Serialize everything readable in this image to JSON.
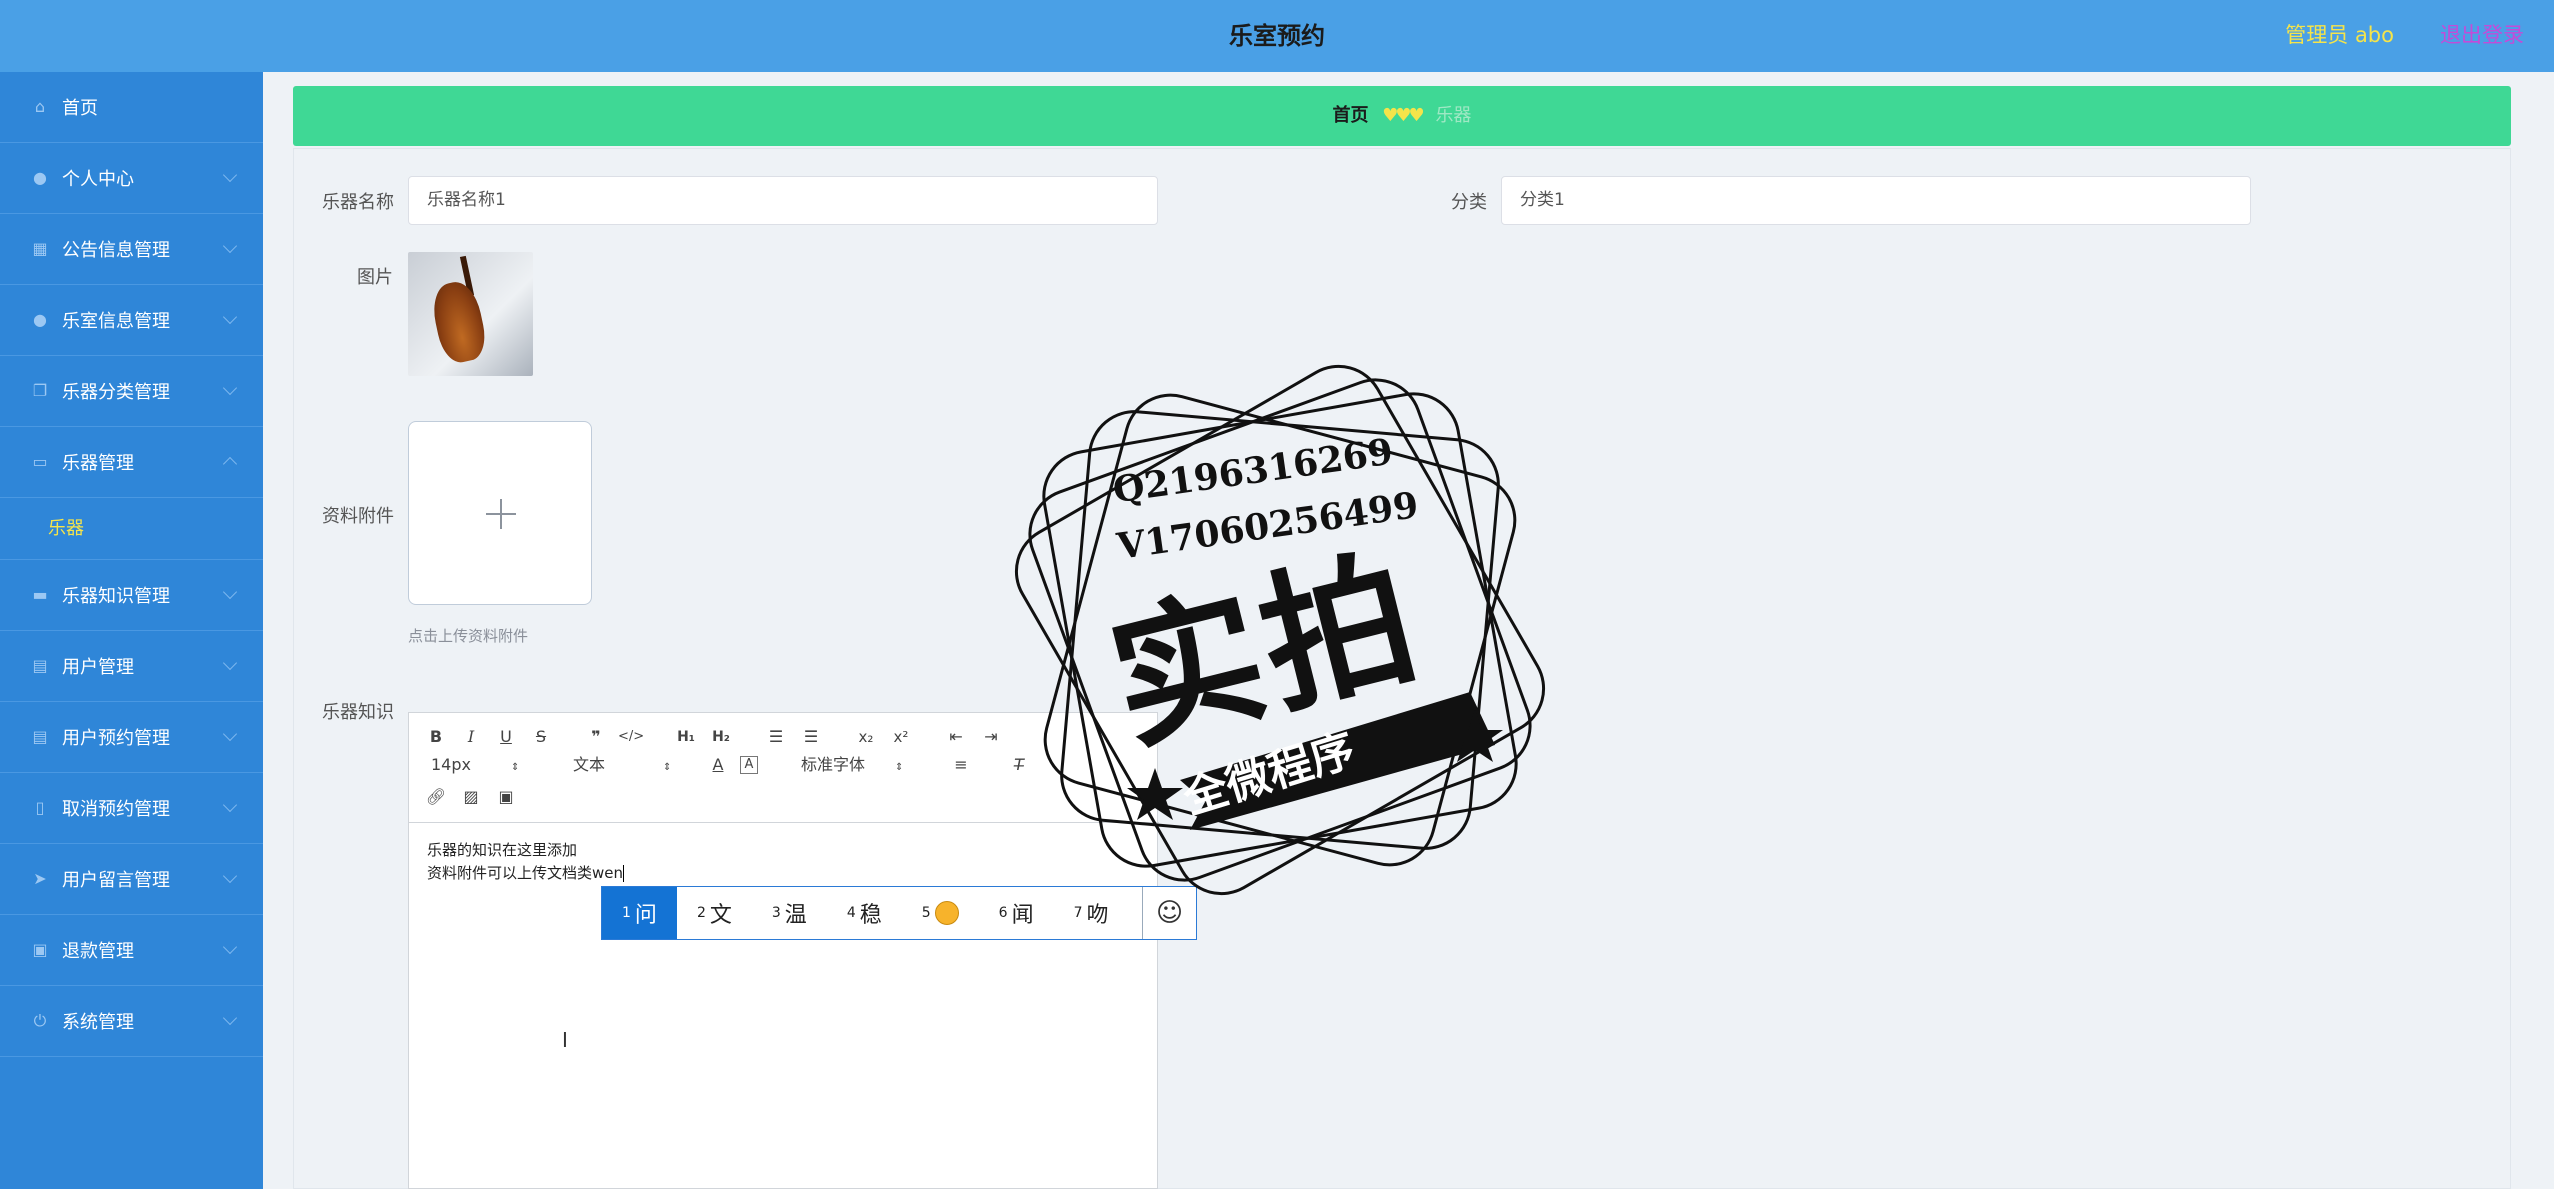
{
  "header": {
    "title": "乐室预约",
    "admin": "管理员 abo",
    "logout": "退出登录"
  },
  "sidebar": {
    "items": [
      {
        "label": "首页",
        "icon": "home-icon"
      },
      {
        "label": "个人中心",
        "icon": "user-icon"
      },
      {
        "label": "公告信息管理",
        "icon": "grid-icon"
      },
      {
        "label": "乐室信息管理",
        "icon": "user-icon"
      },
      {
        "label": "乐器分类管理",
        "icon": "copy-icon"
      },
      {
        "label": "乐器管理",
        "icon": "message-icon"
      },
      {
        "label": "乐器知识管理",
        "icon": "briefcase-icon"
      },
      {
        "label": "用户管理",
        "icon": "clipboard-icon"
      },
      {
        "label": "用户预约管理",
        "icon": "clipboard-icon"
      },
      {
        "label": "取消预约管理",
        "icon": "phone-icon"
      },
      {
        "label": "用户留言管理",
        "icon": "send-icon"
      },
      {
        "label": "退款管理",
        "icon": "image-icon"
      },
      {
        "label": "系统管理",
        "icon": "power-icon"
      }
    ],
    "submenu": {
      "label": "乐器"
    }
  },
  "breadcrumb": {
    "home": "首页",
    "sep": "♥♥♥",
    "current": "乐器"
  },
  "form": {
    "name_label": "乐器名称",
    "name_value": "乐器名称1",
    "category_label": "分类",
    "category_value": "分类1",
    "image_label": "图片",
    "attachment_label": "资料附件",
    "attachment_hint": "点击上传资料附件",
    "knowledge_label": "乐器知识"
  },
  "editor": {
    "font_size": "14px",
    "text_style": "文本",
    "font_family": "标准字体",
    "line1": "乐器的知识在这里添加",
    "line2": "资料附件可以上传文档类wen"
  },
  "ime": {
    "candidates": [
      {
        "num": "1",
        "text": "问"
      },
      {
        "num": "2",
        "text": "文"
      },
      {
        "num": "3",
        "text": "温"
      },
      {
        "num": "4",
        "text": "稳"
      },
      {
        "num": "5",
        "text": ""
      },
      {
        "num": "6",
        "text": "闻"
      },
      {
        "num": "7",
        "text": "吻"
      }
    ]
  },
  "watermark": {
    "line1": "Q2196316269",
    "line2": "V17060256499",
    "big": "实拍",
    "ribbon": "全微程序"
  }
}
